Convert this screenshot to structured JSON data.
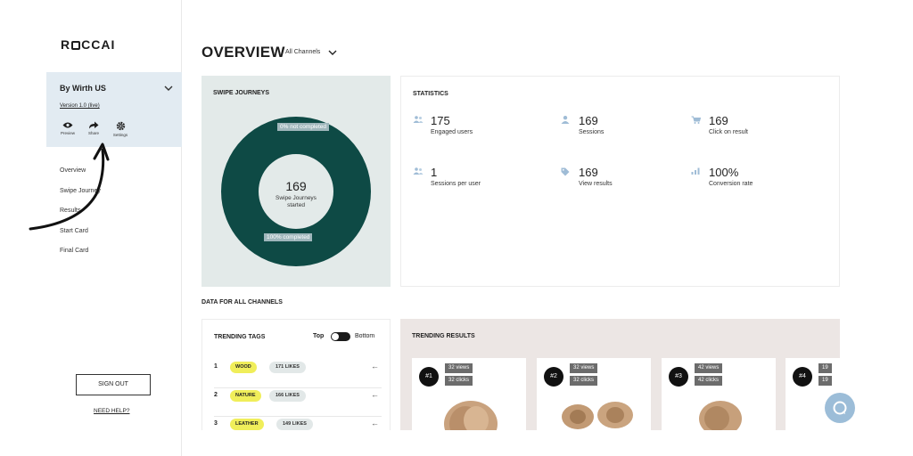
{
  "sidebar": {
    "logo": "ROCCAI",
    "brand": "By Wirth US",
    "version": "Version 1.0 (live)",
    "actions": [
      {
        "label": "Preview",
        "icon": "eye-icon"
      },
      {
        "label": "Share",
        "icon": "share-icon"
      },
      {
        "label": "Settings",
        "icon": "gear-icon"
      }
    ],
    "nav": [
      "Overview",
      "Swipe Journey",
      "Results",
      "Start Card",
      "Final Card"
    ],
    "signout": "SIGN OUT",
    "help": "NEED HELP?"
  },
  "header": {
    "title": "OVERVIEW",
    "channel": "All Channels"
  },
  "swipe": {
    "title": "SWIPE JOURNEYS",
    "not_completed": "0% not completed",
    "completed": "100% completed",
    "started_count": "169",
    "started_label_1": "Swipe Journeys",
    "started_label_2": "started",
    "completed_fraction": 1.0
  },
  "statistics": {
    "title": "STATISTICS",
    "items": [
      {
        "value": "175",
        "label": "Engaged users",
        "icon": "users-icon"
      },
      {
        "value": "169",
        "label": "Sessions",
        "icon": "user-icon"
      },
      {
        "value": "169",
        "label": "Click on result",
        "icon": "cart-icon"
      },
      {
        "value": "1",
        "label": "Sessions per user",
        "icon": "users-icon"
      },
      {
        "value": "169",
        "label": "View results",
        "icon": "tag-icon"
      },
      {
        "value": "100%",
        "label": "Conversion rate",
        "icon": "bar-chart-icon"
      }
    ]
  },
  "data_section": {
    "title": "DATA FOR ALL CHANNELS"
  },
  "trending_tags": {
    "title": "TRENDING TAGS",
    "toggle_left": "Top",
    "toggle_right": "Bottom",
    "rows": [
      {
        "rank": "1",
        "tag": "WOOD",
        "likes": "171 LIKES"
      },
      {
        "rank": "2",
        "tag": "NATURE",
        "likes": "166 LIKES"
      },
      {
        "rank": "3",
        "tag": "LEATHER",
        "likes": "149 LIKES"
      }
    ]
  },
  "trending_results": {
    "title": "TRENDING RESULTS",
    "items": [
      {
        "rank": "#1",
        "views": "32 views",
        "clicks": "32 clicks"
      },
      {
        "rank": "#2",
        "views": "32 views",
        "clicks": "32 clicks"
      },
      {
        "rank": "#3",
        "views": "42 views",
        "clicks": "42 clicks"
      },
      {
        "rank": "#4",
        "views": "19",
        "clicks": "19"
      }
    ]
  },
  "colors": {
    "donut": "#0e4a45",
    "swipe_bg": "#e3eae9",
    "brand_bg": "#e2ebf2",
    "tag_yellow": "#f0ee5a",
    "chat": "#9cbdd8"
  }
}
